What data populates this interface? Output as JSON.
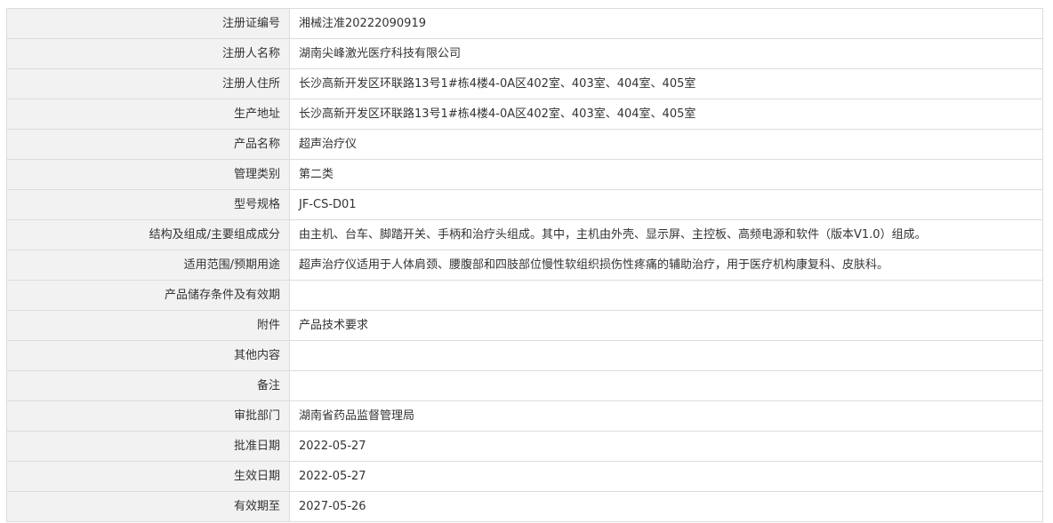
{
  "rows": [
    {
      "label": "注册证编号",
      "value": "湘械注准20222090919"
    },
    {
      "label": "注册人名称",
      "value": "湖南尖峰激光医疗科技有限公司"
    },
    {
      "label": "注册人住所",
      "value": "长沙高新开发区环联路13号1#栋4楼4-0A区402室、403室、404室、405室"
    },
    {
      "label": "生产地址",
      "value": "长沙高新开发区环联路13号1#栋4楼4-0A区402室、403室、404室、405室"
    },
    {
      "label": "产品名称",
      "value": "超声治疗仪"
    },
    {
      "label": "管理类别",
      "value": "第二类"
    },
    {
      "label": "型号规格",
      "value": "JF-CS-D01"
    },
    {
      "label": "结构及组成/主要组成成分",
      "value": "由主机、台车、脚踏开关、手柄和治疗头组成。其中，主机由外壳、显示屏、主控板、高频电源和软件（版本V1.0）组成。"
    },
    {
      "label": "适用范围/预期用途",
      "value": "超声治疗仪适用于人体肩颈、腰腹部和四肢部位慢性软组织损伤性疼痛的辅助治疗，用于医疗机构康复科、皮肤科。"
    },
    {
      "label": "产品储存条件及有效期",
      "value": ""
    },
    {
      "label": "附件",
      "value": "产品技术要求"
    },
    {
      "label": "其他内容",
      "value": ""
    },
    {
      "label": "备注",
      "value": ""
    },
    {
      "label": "审批部门",
      "value": "湖南省药品监督管理局"
    },
    {
      "label": "批准日期",
      "value": "2022-05-27"
    },
    {
      "label": "生效日期",
      "value": "2022-05-27"
    },
    {
      "label": "有效期至",
      "value": "2027-05-26"
    }
  ]
}
